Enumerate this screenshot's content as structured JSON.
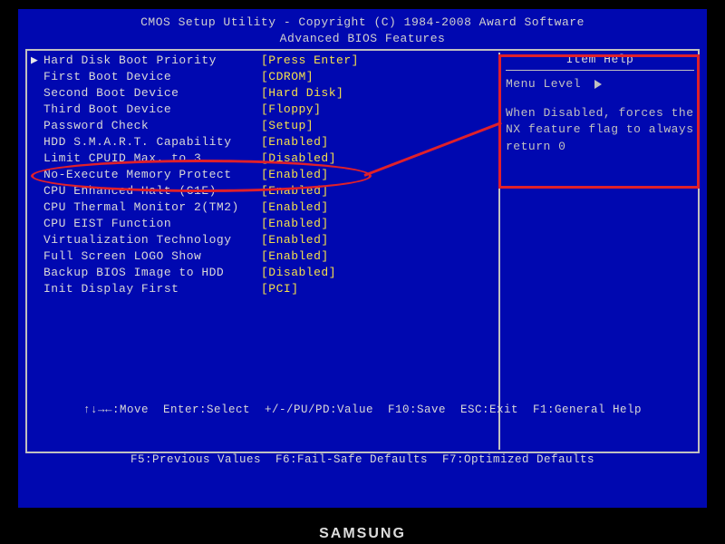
{
  "title1": "CMOS Setup Utility - Copyright (C) 1984-2008 Award Software",
  "title2": "Advanced BIOS Features",
  "settings": [
    {
      "pointer": "▶",
      "label": "Hard Disk Boot Priority",
      "value": "[Press Enter]"
    },
    {
      "pointer": " ",
      "label": "First Boot Device",
      "value": "[CDROM]"
    },
    {
      "pointer": " ",
      "label": "Second Boot Device",
      "value": "[Hard Disk]"
    },
    {
      "pointer": " ",
      "label": "Third Boot Device",
      "value": "[Floppy]"
    },
    {
      "pointer": " ",
      "label": "Password Check",
      "value": "[Setup]"
    },
    {
      "pointer": " ",
      "label": "HDD S.M.A.R.T. Capability",
      "value": "[Enabled]"
    },
    {
      "pointer": " ",
      "label": "Limit CPUID Max. to 3",
      "value": "[Disabled]"
    },
    {
      "pointer": " ",
      "label": "No-Execute Memory Protect",
      "value": "[Enabled]"
    },
    {
      "pointer": " ",
      "label": "CPU Enhanced Halt (C1E)",
      "value": "[Enabled]"
    },
    {
      "pointer": " ",
      "label": "CPU Thermal Monitor 2(TM2)",
      "value": "[Enabled]"
    },
    {
      "pointer": " ",
      "label": "CPU EIST Function",
      "value": "[Enabled]"
    },
    {
      "pointer": " ",
      "label": "Virtualization Technology",
      "value": "[Enabled]"
    },
    {
      "pointer": " ",
      "label": "Full Screen LOGO Show",
      "value": "[Enabled]"
    },
    {
      "pointer": " ",
      "label": "Backup BIOS Image to HDD",
      "value": "[Disabled]"
    },
    {
      "pointer": " ",
      "label": "Init Display First",
      "value": "[PCI]"
    }
  ],
  "help": {
    "title": "Item Help",
    "menu_level": "Menu Level",
    "body": "When Disabled, forces the NX feature flag to always return 0"
  },
  "footer1": "↑↓→←:Move  Enter:Select  +/-/PU/PD:Value  F10:Save  ESC:Exit  F1:General Help",
  "footer2": "F5:Previous Values  F6:Fail-Safe Defaults  F7:Optimized Defaults",
  "brand": "SAMSUNG"
}
